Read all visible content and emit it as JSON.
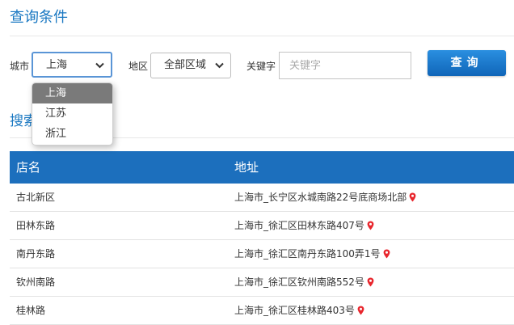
{
  "query": {
    "title": "查询条件",
    "city_label": "城市",
    "city_value": "上海",
    "district_label": "地区",
    "district_value": "全部区域",
    "keyword_label": "关键字",
    "keyword_placeholder": "关键字",
    "keyword_value": "",
    "search_button": "查询"
  },
  "city_dropdown": {
    "options": [
      "上海",
      "江苏",
      "浙江"
    ],
    "selected": "上海"
  },
  "results": {
    "title": "搜索",
    "headers": [
      "店名",
      "地址"
    ],
    "rows": [
      {
        "name": "古北新区",
        "address": "上海市_长宁区水城南路22号底商场北部"
      },
      {
        "name": "田林东路",
        "address": "上海市_徐汇区田林东路407号"
      },
      {
        "name": "南丹东路",
        "address": "上海市_徐汇区南丹东路100弄1号"
      },
      {
        "name": "钦州南路",
        "address": "上海市_徐汇区钦州南路552号"
      },
      {
        "name": "桂林路",
        "address": "上海市_徐汇区桂林路403号"
      }
    ]
  },
  "colors": {
    "accent": "#1a78c2",
    "table_header": "#1c6fbd",
    "pin": "#e8262d"
  },
  "icons": {
    "pin": "map-pin-icon",
    "select_arrow": "chevron-down-icon"
  }
}
